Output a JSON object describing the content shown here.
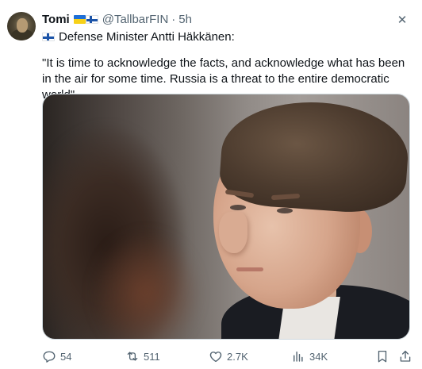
{
  "tweet": {
    "author_name": "Tomi",
    "handle": "@TallbarFIN",
    "separator": "·",
    "time": "5h",
    "close_glyph": "✕",
    "line1": "Defense Minister Antti Häkkänen:",
    "quote": "\"It is time to acknowledge the facts, and acknowledge what has been in the air for some time. Russia is a threat to the entire democratic world\"",
    "flags": [
      "ukraine-flag-icon",
      "finland-flag-icon"
    ]
  },
  "actions": {
    "replies": "54",
    "reposts": "511",
    "likes": "2.7K",
    "views": "34K"
  },
  "colors": {
    "text": "#0f1419",
    "secondary": "#536471",
    "border": "#cfd9de"
  }
}
